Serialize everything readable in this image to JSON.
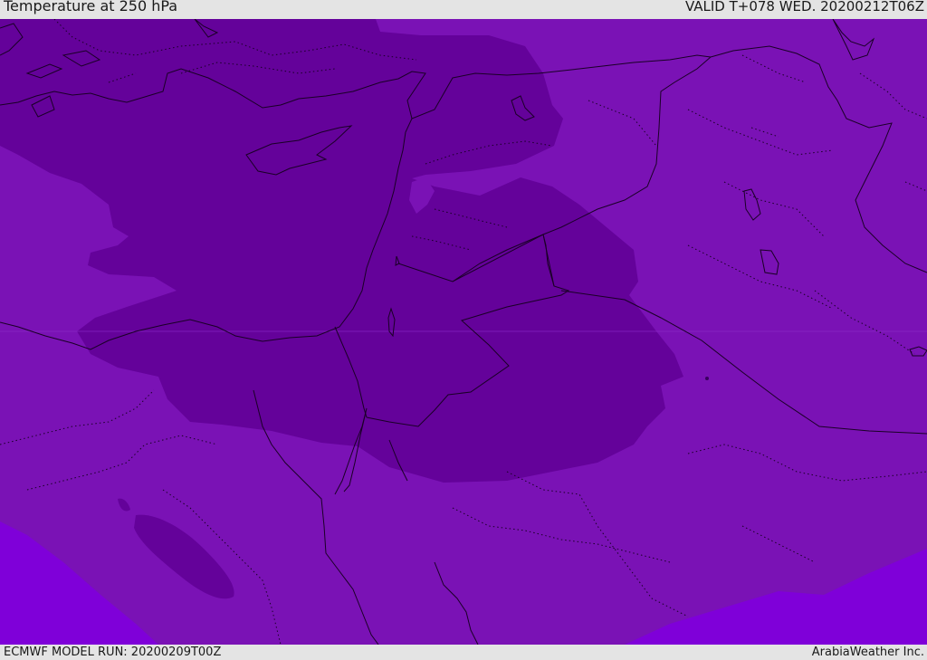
{
  "header": {
    "title": "Temperature at 250 hPa",
    "valid_time": "VALID T+078 WED. 20200212T06Z"
  },
  "footer": {
    "model_run": "ECMWF MODEL RUN: 20200209T00Z",
    "credit": "ArabiaWeather Inc."
  },
  "map": {
    "colors": {
      "background_band": "#7a12b5",
      "cold_core": "#64029a",
      "warm_edge": "#7f00d9",
      "lines": "#1a0026"
    }
  }
}
